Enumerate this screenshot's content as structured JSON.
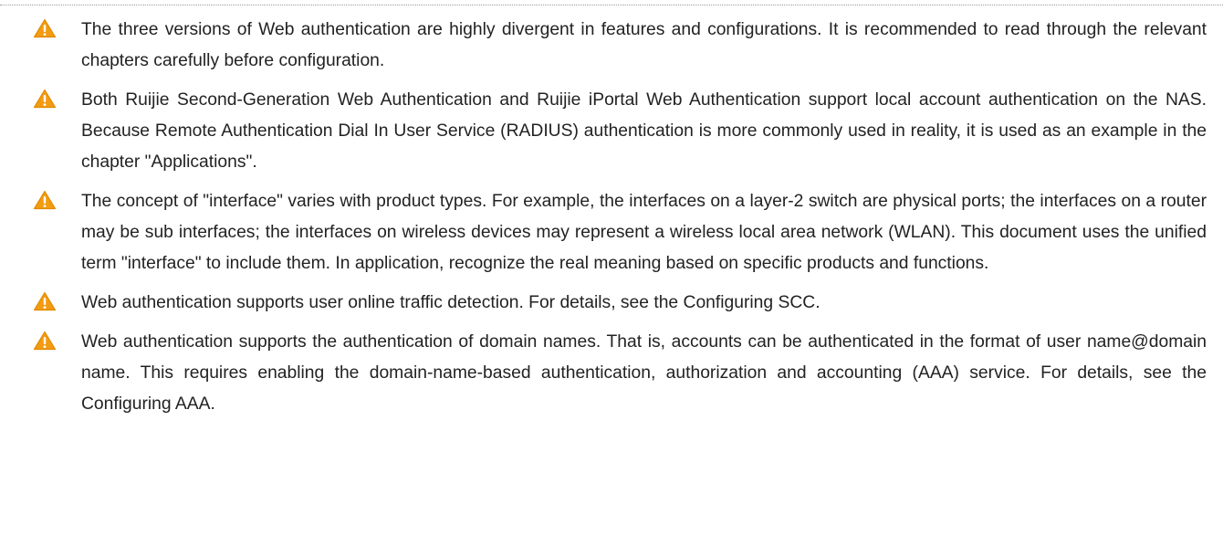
{
  "icons": {
    "caution": "warning-triangle-icon",
    "fill": "#f39c12",
    "mark": "#ffffff"
  },
  "notes": [
    "The three versions of Web authentication are highly divergent in features and configurations. It is recommended to read through the relevant chapters carefully before configuration.",
    "Both Ruijie Second-Generation Web Authentication and Ruijie iPortal Web Authentication support local account authentication on the NAS. Because Remote Authentication Dial In User Service (RADIUS) authentication is more commonly used in reality, it is used as an example in the chapter \"Applications\".",
    "The concept of \"interface\" varies with product types. For example, the interfaces on a layer-2 switch are physical ports; the interfaces on a router may be sub interfaces; the interfaces on wireless devices may represent a wireless local area network (WLAN). This document uses the unified term \"interface\" to include them. In application, recognize the real meaning based on specific products and functions.",
    "Web authentication supports user online traffic detection. For details, see the Configuring SCC.",
    "Web authentication supports the authentication of domain names. That is, accounts can be authenticated in the format of user name@domain name. This requires enabling the domain-name-based authentication, authorization and accounting (AAA) service. For details, see the Configuring AAA."
  ]
}
